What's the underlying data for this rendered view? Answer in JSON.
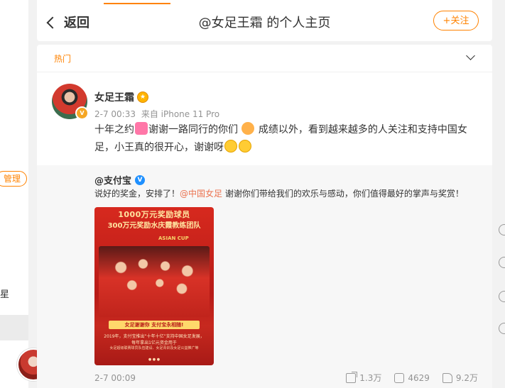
{
  "header": {
    "back_label": "返回",
    "title": "@女足王霜 的个人主页",
    "follow_label": "+关注"
  },
  "feed": {
    "tab_label": "热门"
  },
  "sidebar_left": {
    "manage_label": "管理",
    "partial_text": "星"
  },
  "post": {
    "author": "女足王霜",
    "time": "2-7 00:33",
    "source": "来自 iPhone 11 Pro",
    "text_part1": "十年之约",
    "text_part2": "谢谢一路同行的你们",
    "text_part3": " 成绩以外，看到越来越多的人关注和支持中国女足，小王真的很开心，谢谢呀",
    "repost": {
      "author": "@支付宝",
      "text_before": "说好的奖金，安排了！",
      "mention": "@中国女足",
      "text_after": " 谢谢你们带给我们的欢乐与感动，你们值得最好的掌声与奖赏！",
      "time": "2-7 00:09",
      "share_count": "1.3万",
      "comment_count": "4629",
      "like_count": "9.2万",
      "poster": {
        "headline1": "1000万元奖励球员",
        "headline2": "300万元奖励水庆霞教练团队",
        "cup": "ASIAN CUP",
        "banner": "女足谢谢你 支付宝永相随!",
        "line1": "2019年，支付宝推出“十年十亿”支持中国女足发展，",
        "line1b": "每年拿出1亿元资金用于",
        "line2": "女足超级联赛球员队伍建设、女足青训及女足公益推广等"
      }
    }
  },
  "colors": {
    "accent": "#ff8200",
    "mention": "#eb7350",
    "meta": "#939393"
  }
}
